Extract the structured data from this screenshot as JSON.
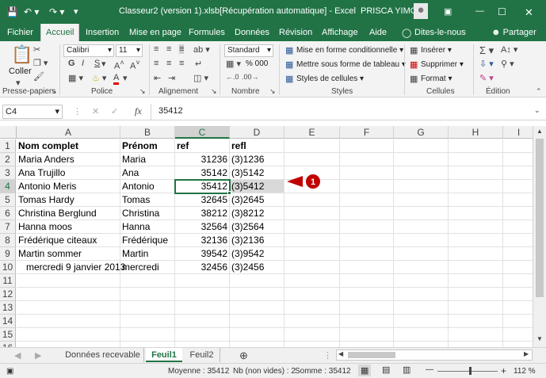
{
  "title": {
    "filename": "Classeur2 (version 1).xlsb[Récupération automatique]  -  Excel",
    "user": "PRISCA YIMGA",
    "save_icon": "save-icon",
    "undo_icon": "undo-icon",
    "redo_icon": "redo-icon"
  },
  "tabs": [
    "Fichier",
    "Accueil",
    "Insertion",
    "Mise en page",
    "Formules",
    "Données",
    "Révision",
    "Affichage",
    "Aide",
    "Dites-le-nous",
    "Partager"
  ],
  "ribbon": {
    "clipboard": {
      "paste": "Coller",
      "label": "Presse-papiers"
    },
    "font": {
      "name": "Calibri",
      "size": "11",
      "bold": "G",
      "italic": "I",
      "underline": "S",
      "label": "Police"
    },
    "alignment": {
      "label": "Alignement"
    },
    "number": {
      "format": "Standard",
      "percent": "% 000",
      "label": "Nombre"
    },
    "styles": {
      "conditional": "Mise en forme conditionnelle",
      "table": "Mettre sous forme de tableau",
      "cell_styles": "Styles de cellules",
      "label": "Styles"
    },
    "cells": {
      "insert": "Insérer",
      "delete": "Supprimer",
      "format": "Format",
      "label": "Cellules"
    },
    "editing": {
      "label": "Édition"
    }
  },
  "formula_bar": {
    "name_box": "C4",
    "fx": "fx",
    "value": "35412"
  },
  "columns": [
    "A",
    "B",
    "C",
    "D",
    "E",
    "F",
    "G",
    "H",
    "I"
  ],
  "rows": [
    [
      "Nom complet",
      "Prénom",
      "ref",
      "refl"
    ],
    [
      "Maria Anders",
      "Maria",
      "31236",
      "(3)1236"
    ],
    [
      "Ana Trujillo",
      "Ana",
      "35142",
      "(3)5142"
    ],
    [
      "Antonio Meris",
      "Antonio",
      "35412",
      "(3)5412"
    ],
    [
      "Tomas Hardy",
      "Tomas",
      "32645",
      "(3)2645"
    ],
    [
      "Christina Berglund",
      "Christina",
      "38212",
      "(3)8212"
    ],
    [
      "Hanna moos",
      "Hanna",
      "32564",
      "(3)2564"
    ],
    [
      "Frédérique citeaux",
      "Frédérique",
      "32136",
      "(3)2136"
    ],
    [
      "Martin sommer",
      "Martin",
      "39542",
      "(3)9542"
    ],
    [
      "   mercredi 9 janvier 2013",
      "mercredi",
      "32456",
      "(3)2456"
    ]
  ],
  "row_numbers": [
    "1",
    "2",
    "3",
    "4",
    "5",
    "6",
    "7",
    "8",
    "9",
    "10",
    "11",
    "12",
    "13",
    "14",
    "15",
    "16"
  ],
  "callout": "1",
  "sheets": [
    "Données recevable",
    "Feuil1",
    "Feuil2"
  ],
  "active_sheet": "Feuil1",
  "status": {
    "average": "Moyenne : 35412",
    "count": "Nb (non vides) : 2",
    "sum": "Somme : 35412",
    "zoom": "112 %"
  },
  "colors": {
    "excel_green": "#217346",
    "callout_red": "#c00000"
  }
}
